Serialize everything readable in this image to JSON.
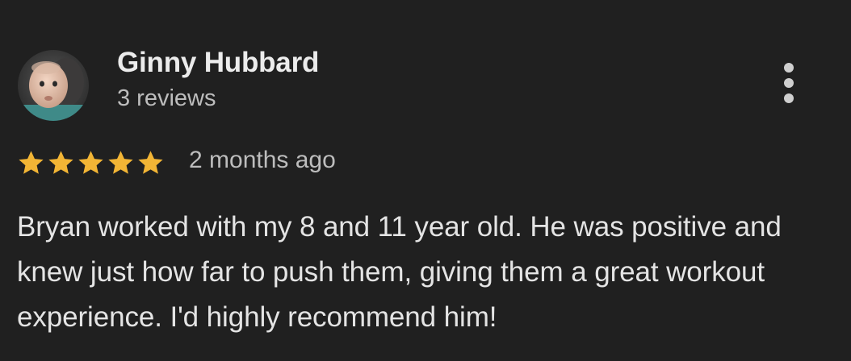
{
  "reviewer": {
    "name": "Ginny Hubbard",
    "review_count": "3 reviews",
    "avatar_icon": "profile-photo"
  },
  "review": {
    "rating": 5,
    "max_rating": 5,
    "date": "2 months ago",
    "text": "Bryan worked with my 8 and 11 year old. He was positive and knew just how far to push them, giving them a great workout experience. I'd highly recommend him!"
  },
  "actions": {
    "more_icon": "more-vertical-icon"
  },
  "colors": {
    "background": "#202020",
    "star": "#F2B535",
    "text_primary": "#E8E8E8",
    "text_secondary": "#BDBDBD"
  }
}
